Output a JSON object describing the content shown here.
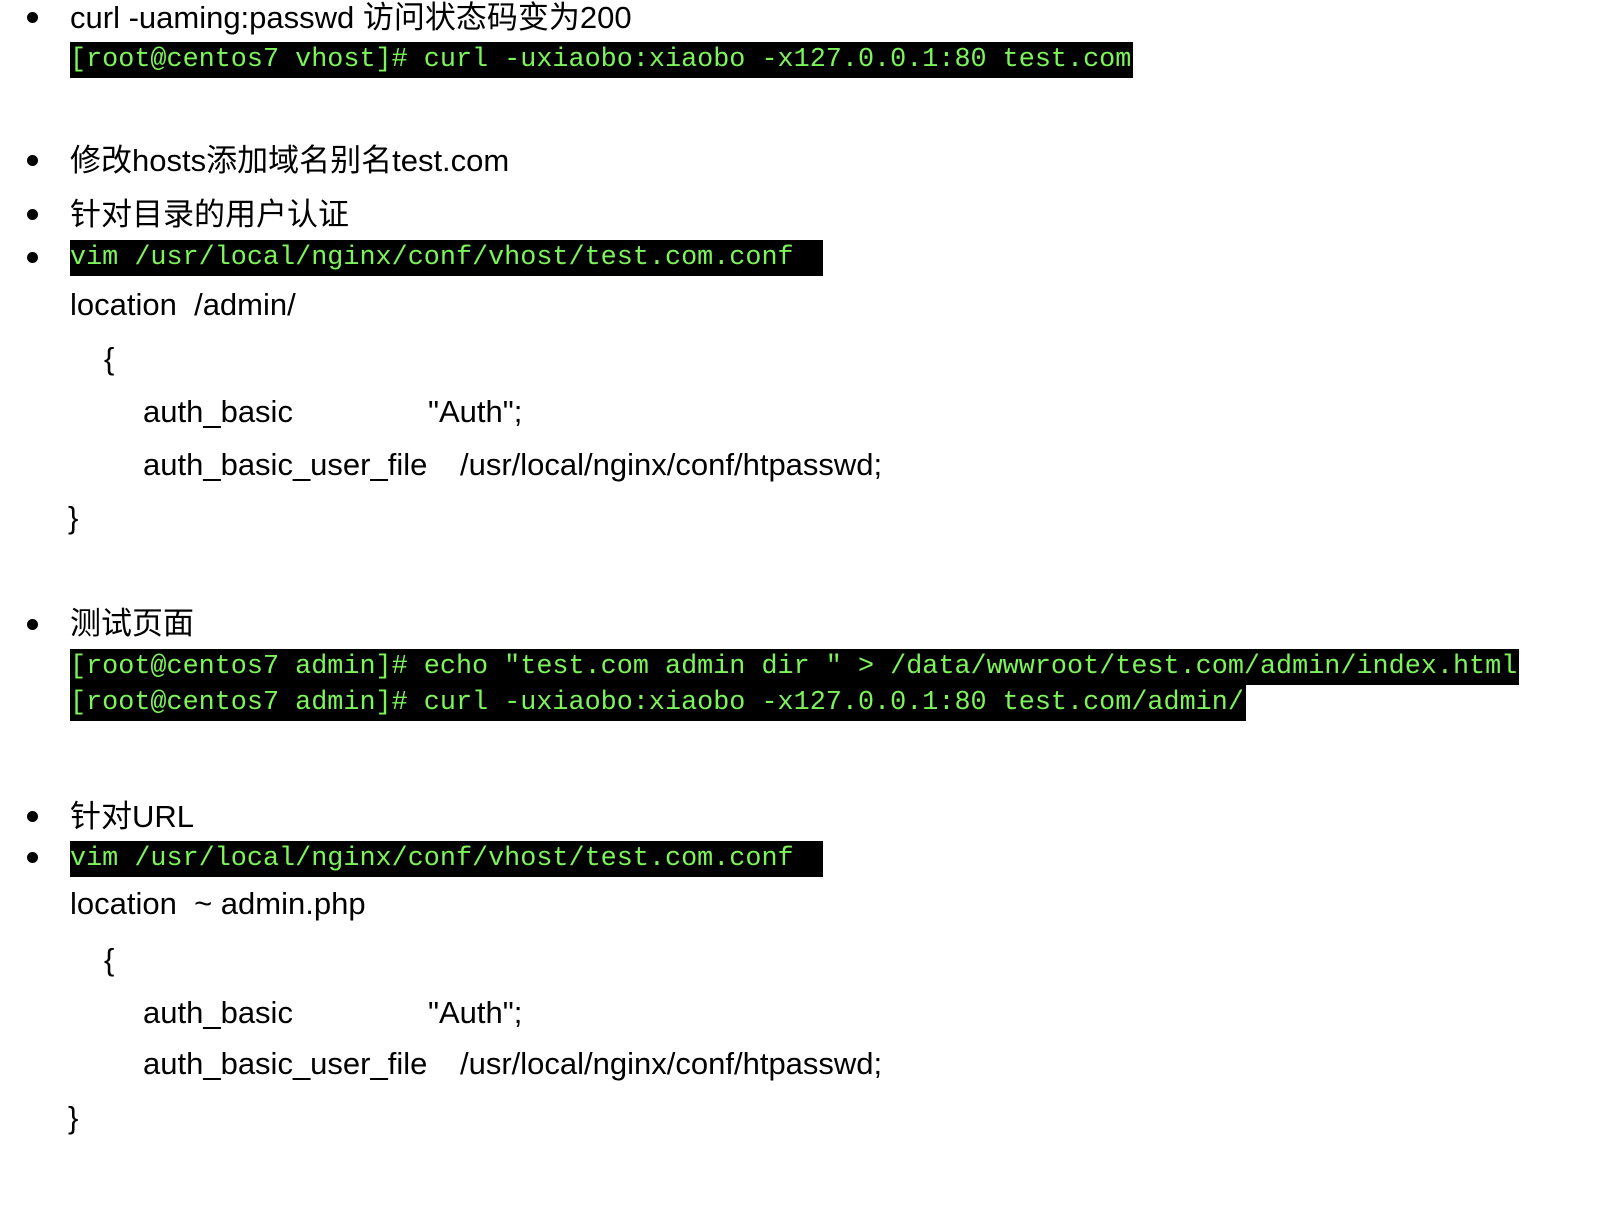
{
  "items": {
    "curl_heading": "curl -uaming:passwd 访问状态码变为200",
    "curl_cmd": "[root@centos7 vhost]# curl -uxiaobo:xiaobo -x127.0.0.1:80 test.com",
    "hosts": "修改hosts添加域名别名test.com",
    "dir_auth": "针对目录的用户认证",
    "vim_cmd_1": "vim /usr/local/nginx/conf/vhost/test.com.conf ",
    "loc1": "location  /admin/",
    "test_page": "测试页面",
    "echo_cmd": "[root@centos7 admin]# echo \"test.com admin dir \" > /data/wwwroot/test.com/admin/index.html",
    "curl_admin_cmd": "[root@centos7 admin]# curl -uxiaobo:xiaobo -x127.0.0.1:80 test.com/admin/",
    "url_auth": "针对URL",
    "vim_cmd_2": "vim /usr/local/nginx/conf/vhost/test.com.conf ",
    "loc2": "location  ~ admin.php"
  },
  "block": {
    "open": "{",
    "auth_basic_key": "auth_basic",
    "auth_basic_val": "\"Auth\";",
    "user_file_key": "auth_basic_user_file",
    "user_file_val": "/usr/local/nginx/conf/htpasswd;",
    "close": "}"
  },
  "colors": {
    "terminal_bg": "#000000",
    "terminal_text": "#7cf45a"
  }
}
